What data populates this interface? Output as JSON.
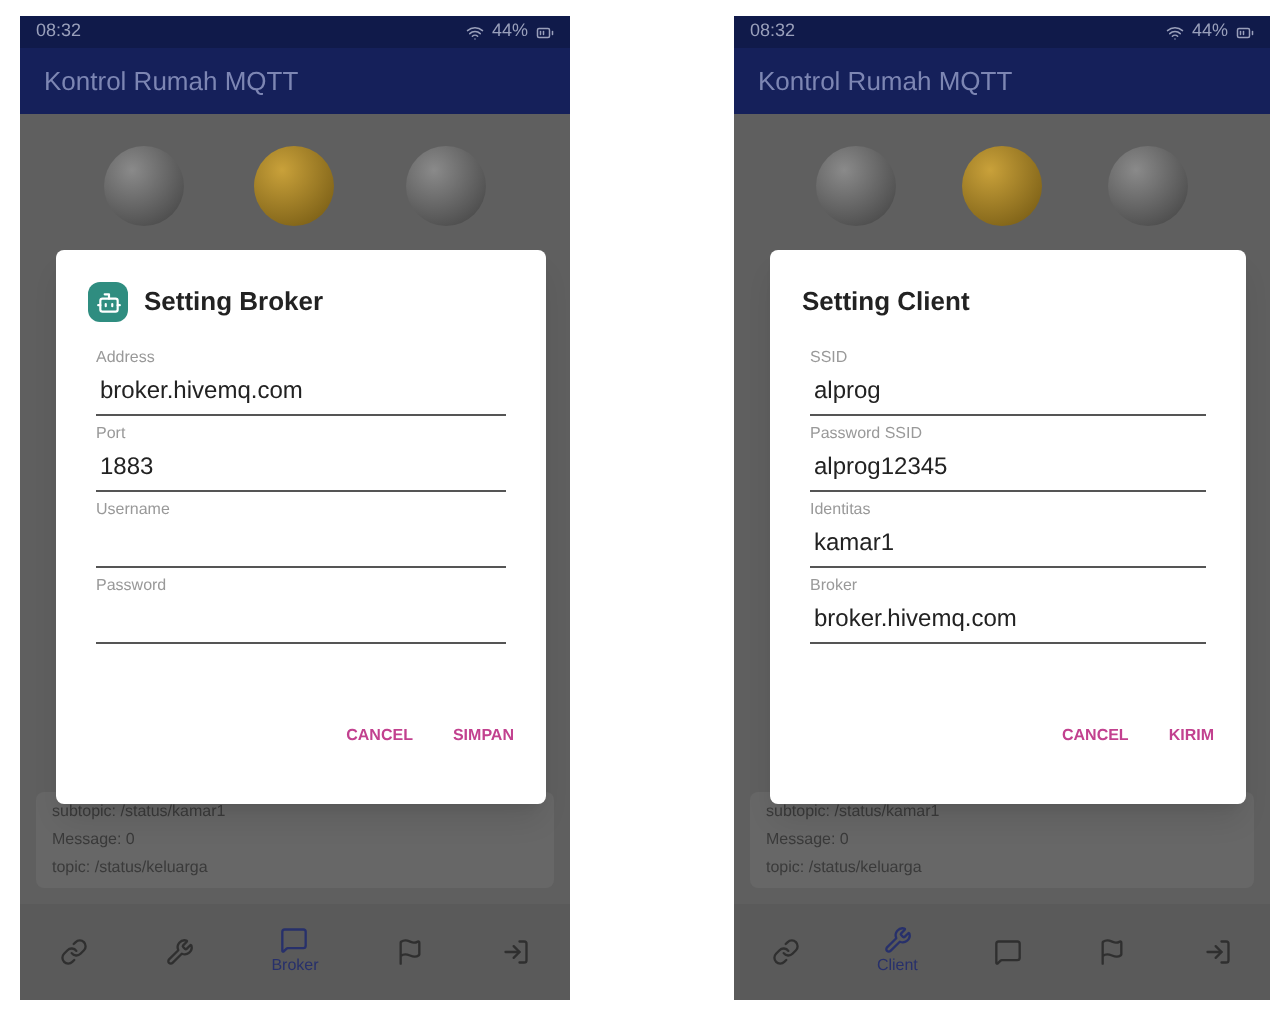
{
  "phones": [
    {
      "status_bar": {
        "time": "08:32",
        "battery": "44%"
      },
      "app_bar": {
        "title": "Kontrol Rumah MQTT"
      },
      "lamps": [
        {
          "on": false
        },
        {
          "on": true
        },
        {
          "on": false
        }
      ],
      "dialog": {
        "title": "Setting Broker",
        "has_icon": true,
        "fields": [
          {
            "label": "Address",
            "value": "broker.hivemq.com"
          },
          {
            "label": "Port",
            "value": "1883"
          },
          {
            "label": "Username"
          },
          {
            "label": "Password"
          }
        ],
        "buttons": [
          "CANCEL",
          "SIMPAN"
        ]
      },
      "background_lines": [
        "subtopic: /status/kamar1",
        "Message: 0",
        "topic: /status/keluarga"
      ],
      "bottom_nav": [
        {
          "selected": false
        },
        {
          "selected": false
        },
        {
          "label": "Broker",
          "selected": true
        },
        {
          "selected": false
        },
        {
          "selected": false
        }
      ]
    },
    {
      "status_bar": {
        "time": "08:32",
        "battery": "44%"
      },
      "app_bar": {
        "title": "Kontrol Rumah MQTT"
      },
      "lamps": [
        {
          "on": false
        },
        {
          "on": true
        },
        {
          "on": false
        }
      ],
      "dialog": {
        "title": "Setting Client",
        "has_icon": false,
        "fields": [
          {
            "label": "SSID",
            "value": "alprog"
          },
          {
            "label": "Password SSID",
            "value": "alprog12345"
          },
          {
            "label": "Identitas",
            "value": "kamar1"
          },
          {
            "label": "Broker",
            "value": "broker.hivemq.com"
          }
        ],
        "buttons": [
          "CANCEL",
          "KIRIM"
        ]
      },
      "background_lines": [
        "subtopic: /status/kamar1",
        "Message: 0",
        "topic: /status/keluarga"
      ],
      "bottom_nav": [
        {
          "selected": false
        },
        {
          "label": "Client",
          "selected": true
        },
        {
          "selected": false
        },
        {
          "selected": false
        },
        {
          "selected": false
        }
      ]
    }
  ]
}
